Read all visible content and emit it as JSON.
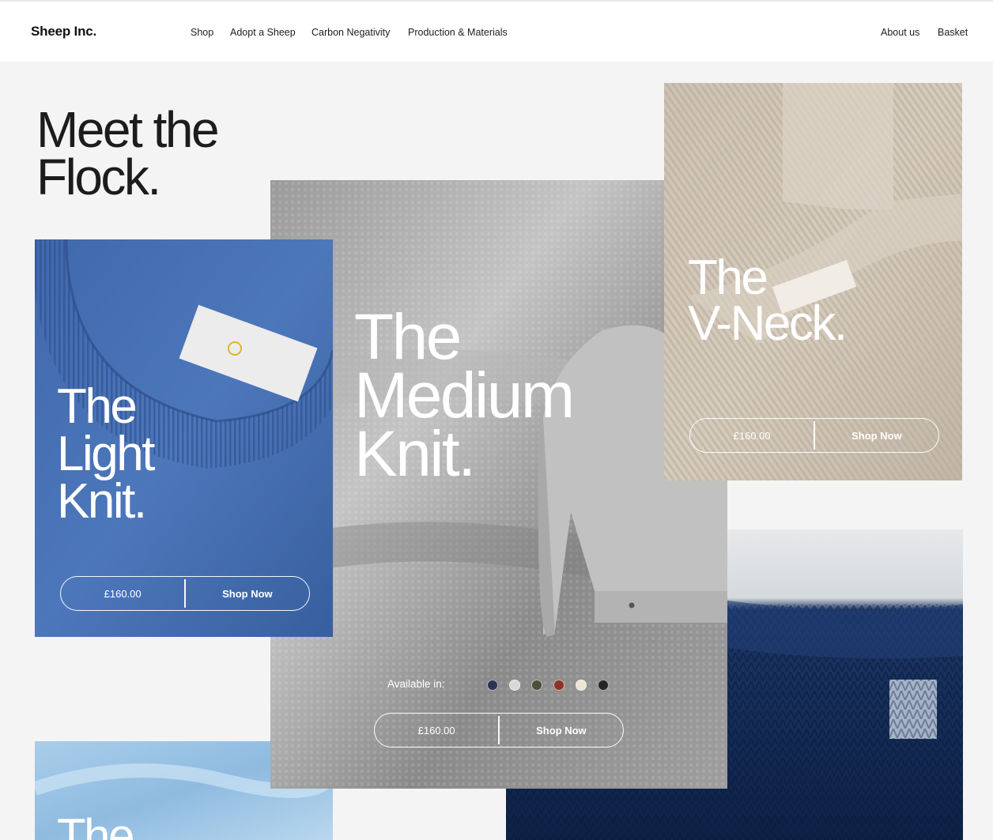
{
  "header": {
    "logo": "Sheep Inc.",
    "nav_left": [
      "Shop",
      "Adopt a Sheep",
      "Carbon Negativity",
      "Production & Materials"
    ],
    "nav_right": [
      "About us",
      "Basket"
    ]
  },
  "hero": {
    "title_line1": "Meet the",
    "title_line2": "Flock."
  },
  "products": {
    "light": {
      "title": [
        "The",
        "Light",
        "Knit."
      ],
      "price": "£160.00",
      "cta": "Shop Now"
    },
    "medium": {
      "title": [
        "The",
        "Medium",
        "Knit."
      ],
      "price": "£160.00",
      "cta": "Shop Now",
      "available_label": "Available in:",
      "colors": [
        "#2a3550",
        "#d8d8d8",
        "#4b4f3c",
        "#8a3426",
        "#efe4d4",
        "#252525"
      ]
    },
    "vneck": {
      "title": [
        "The",
        "V-Neck."
      ],
      "price": "£160.00",
      "cta": "Shop Now"
    },
    "partial": {
      "title": [
        "The"
      ]
    }
  }
}
